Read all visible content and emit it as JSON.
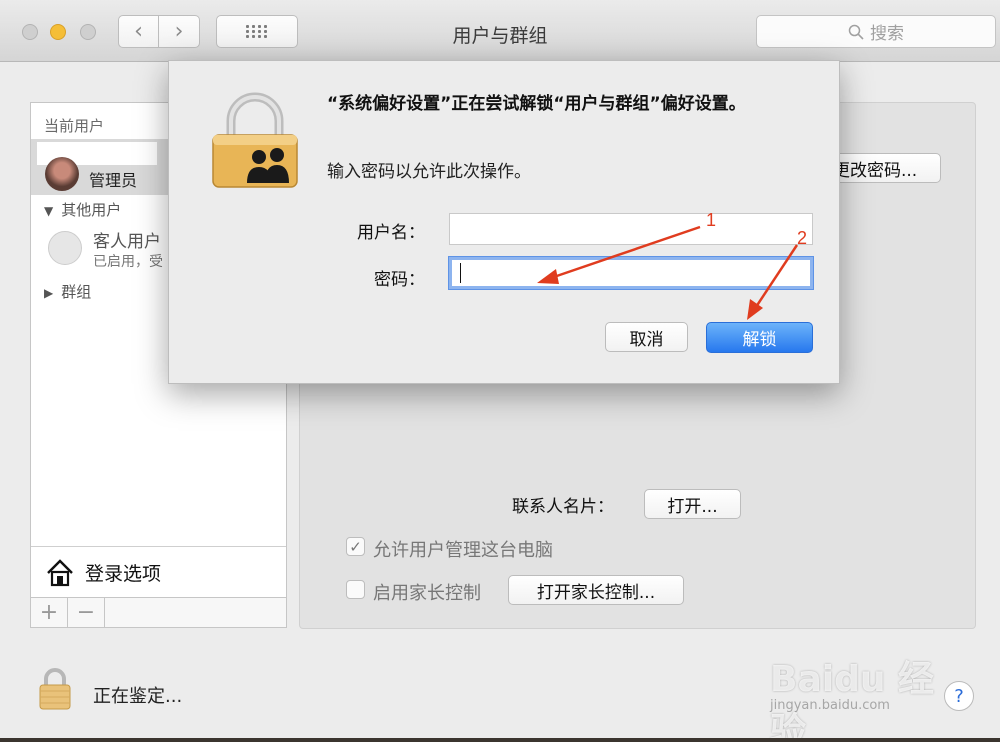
{
  "window": {
    "title": "用户与群组",
    "search_placeholder": "搜索",
    "back_glyph": "‹",
    "forward_glyph": "›"
  },
  "sidebar": {
    "current_users_header": "当前用户",
    "admin_role": "管理员",
    "other_users_header": "其他用户",
    "guest_name": "客人用户",
    "guest_status": "已启用，受",
    "groups_label": "群组",
    "login_options": "登录选项",
    "add_glyph": "+",
    "remove_glyph": "−"
  },
  "main": {
    "change_password": "更改密码...",
    "contact_card_label": "联系人名片：",
    "open_button": "打开...",
    "allow_admin": "允许用户管理这台电脑",
    "parental_controls": "启用家长控制",
    "open_parental_button": "打开家长控制..."
  },
  "footer": {
    "status": "正在鉴定...",
    "help": "?"
  },
  "dialog": {
    "title": "“系统偏好设置”正在尝试解锁“用户与群组”偏好设置。",
    "subtitle": "输入密码以允许此次操作。",
    "username_label": "用户名：",
    "username_value": "",
    "password_label": "密码：",
    "cancel_button": "取消",
    "unlock_button": "解锁"
  },
  "annotations": {
    "arrow1_label": "1",
    "arrow2_label": "2",
    "color": "#e03c1f"
  },
  "watermark": {
    "logo": "Baidu 经验",
    "url": "jingyan.baidu.com"
  },
  "colors": {
    "accent": "#2f7ff0",
    "selection": "#d9d9d9"
  }
}
